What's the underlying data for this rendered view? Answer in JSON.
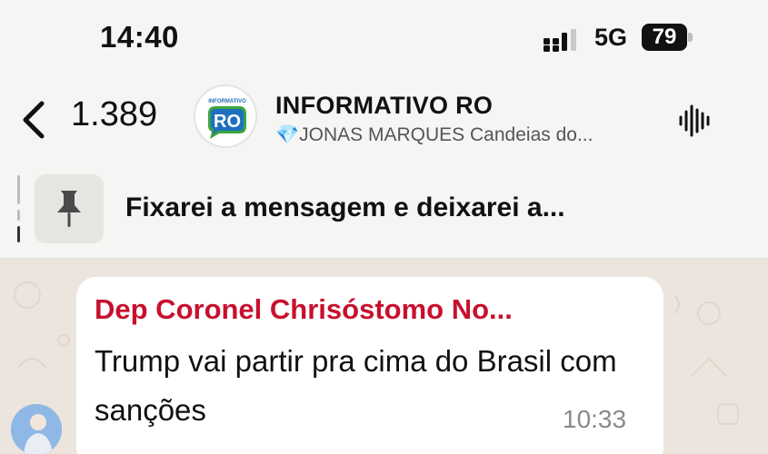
{
  "status_bar": {
    "time": "14:40",
    "network": "5G",
    "battery": "79"
  },
  "header": {
    "unread_count": "1.389",
    "title": "INFORMATIVO RO",
    "subtitle_gem": "💎",
    "subtitle": "JONAS MARQUES  Candeias do...",
    "logo_small_text": "INFORMATIVO",
    "logo_text": "RO"
  },
  "pinned": {
    "text": "Fixarei a mensagem e deixarei a..."
  },
  "message": {
    "sender": "Dep Coronel Chrisóstomo No...",
    "text": "Trump vai partir pra cima do Brasil com sanções",
    "time": "10:33"
  },
  "colors": {
    "sender_name": "#c8102e",
    "background": "#f6f5f3",
    "chat_bg": "#ece5dd",
    "logo_green": "#3aa640",
    "logo_blue": "#1e6fc0"
  },
  "icons": [
    "back-chevron-icon",
    "voice-waveform-icon",
    "pin-icon",
    "gem-icon"
  ]
}
